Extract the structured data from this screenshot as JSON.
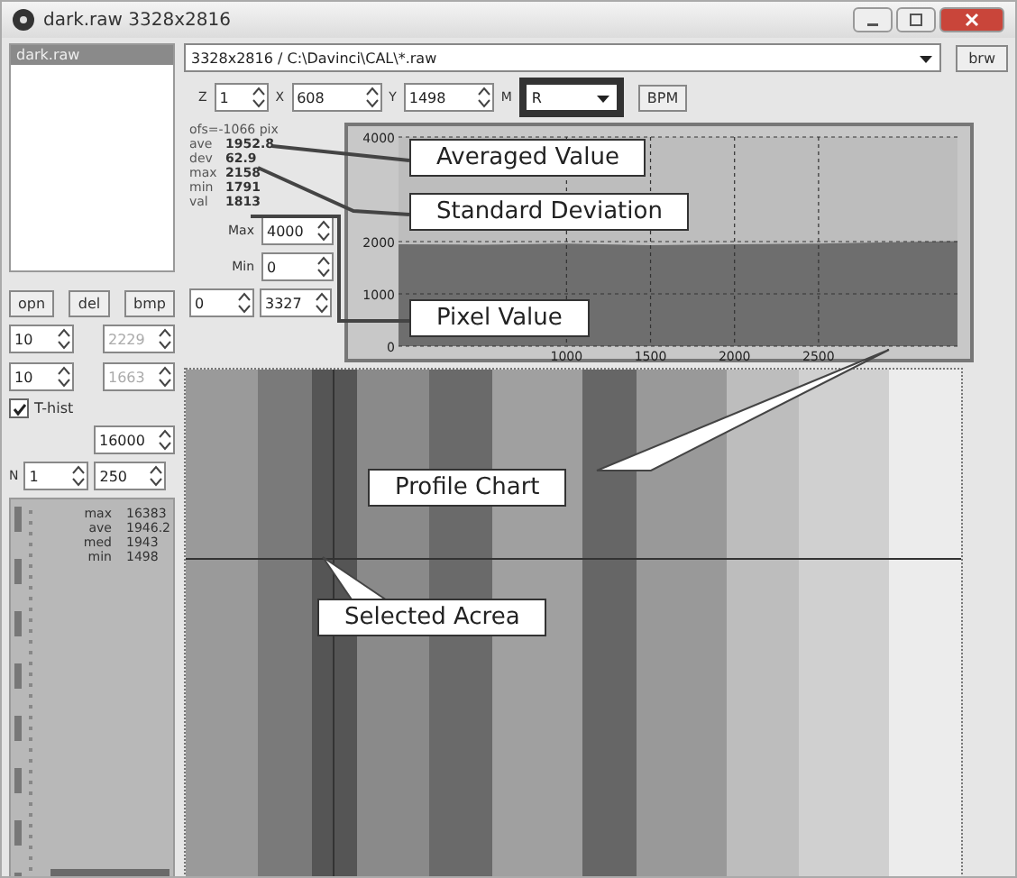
{
  "window": {
    "title": "dark.raw 3328x2816"
  },
  "file_list": {
    "items": [
      {
        "label": "dark.raw",
        "selected": true
      }
    ]
  },
  "file_buttons": [
    "opn",
    "del",
    "bmp"
  ],
  "left_spinners": [
    {
      "value": "10",
      "disabled": false
    },
    {
      "value": "2229",
      "disabled": true
    },
    {
      "value": "10",
      "disabled": false
    },
    {
      "value": "1663",
      "disabled": true
    }
  ],
  "t_hist": {
    "label": "T-hist",
    "checked": true,
    "value": "16000"
  },
  "n_spinner": {
    "label": "N",
    "value": "1",
    "value_2": "250"
  },
  "histogram": {
    "stats": [
      {
        "name": "max",
        "value": "16383"
      },
      {
        "name": "ave",
        "value": "1946.2"
      },
      {
        "name": "med",
        "value": "1943"
      },
      {
        "name": "min",
        "value": "1498"
      }
    ]
  },
  "path_combo": {
    "value": "3328x2816 / C:\\Davinci\\CAL\\*.raw"
  },
  "browse_button": "brw",
  "coords": [
    {
      "label": "Z",
      "value": "1"
    },
    {
      "label": "X",
      "value": "608"
    },
    {
      "label": "Y",
      "value": "1498"
    }
  ],
  "mode": {
    "label": "M",
    "value": "R",
    "highlighted": true
  },
  "bpm_button": "BPM",
  "stats": {
    "offset": "ofs=-1066 pix",
    "rows": [
      {
        "name": "ave",
        "value": "1952.8"
      },
      {
        "name": "dev",
        "value": "62.9"
      },
      {
        "name": "max",
        "value": "2158"
      },
      {
        "name": "min",
        "value": "1791"
      },
      {
        "name": "val",
        "value": "1813"
      }
    ]
  },
  "range": {
    "max_label": "Max",
    "max": "4000",
    "min_label": "Min",
    "min": "0",
    "from": "0",
    "to": "3327"
  },
  "profile": {
    "chart_data": {
      "type": "area",
      "x": [
        0,
        500,
        1000,
        1500,
        2000,
        2500,
        3000,
        3327
      ],
      "grid": true,
      "series": [
        {
          "color": "#6e6e6e",
          "values": [
            1950,
            1940,
            1960,
            1930,
            1950,
            1960,
            1990,
            2010
          ]
        }
      ],
      "xlim": [
        0,
        3327
      ],
      "ylim": [
        0,
        4000
      ],
      "xticks": [
        1000,
        1500,
        2000,
        2500
      ],
      "yticks": [
        0,
        1000,
        2000,
        4000
      ]
    }
  },
  "image": {
    "kind": "picture"
  },
  "callouts": [
    {
      "text": "Averaged Value"
    },
    {
      "text": "Standard Deviation"
    },
    {
      "text": "Pixel Value"
    },
    {
      "text": "Profile Chart"
    },
    {
      "text": "Selected Acrea"
    }
  ]
}
